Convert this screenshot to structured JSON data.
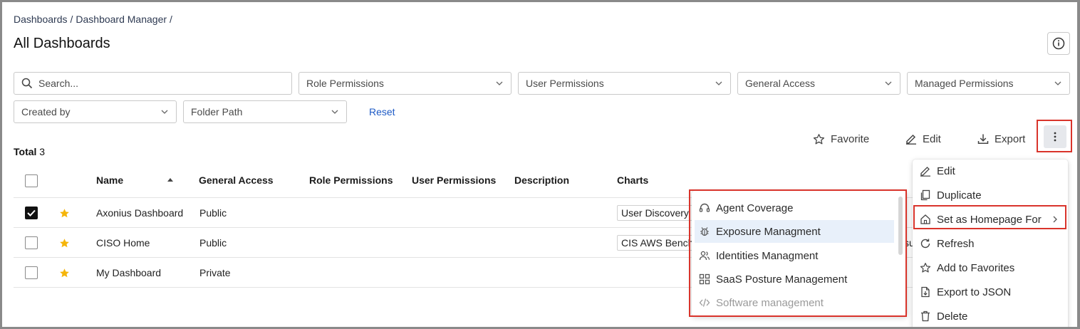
{
  "breadcrumb": [
    "Dashboards",
    "/",
    "Dashboard Manager",
    "/"
  ],
  "page_title": "All Dashboards",
  "filters": {
    "search_placeholder": "Search...",
    "role_permissions": "Role Permissions",
    "user_permissions": "User Permissions",
    "general_access": "General Access",
    "managed_permissions": "Managed Permissions",
    "created_by": "Created by",
    "folder_path": "Folder Path",
    "reset": "Reset"
  },
  "toolbar": {
    "favorite": "Favorite",
    "edit": "Edit",
    "export": "Export"
  },
  "total": {
    "label": "Total",
    "count": "3"
  },
  "table": {
    "columns": [
      "Name",
      "General Access",
      "Role Permissions",
      "User Permissions",
      "Description",
      "Charts"
    ],
    "rows": [
      {
        "name": "Axonius Dashboard",
        "access": "Public",
        "chart": "User Discovery",
        "checked": true
      },
      {
        "name": "CISO Home",
        "access": "Public",
        "chart": "CIS AWS Benchm",
        "chart2": "su",
        "checked": false
      },
      {
        "name": "My Dashboard",
        "access": "Private",
        "chart": "",
        "checked": false
      }
    ]
  },
  "context_menu": {
    "items": [
      "Edit",
      "Duplicate",
      "Set as Homepage For",
      "Refresh",
      "Add to Favorites",
      "Export to JSON",
      "Delete"
    ]
  },
  "submenu": {
    "items": [
      "Agent Coverage",
      "Exposure Managment",
      "Identities Managment",
      "SaaS Posture Management",
      "Software management"
    ]
  },
  "colors": {
    "accent": "#1e5bc6",
    "highlight": "#d9342b",
    "star": "#f5b50a"
  }
}
